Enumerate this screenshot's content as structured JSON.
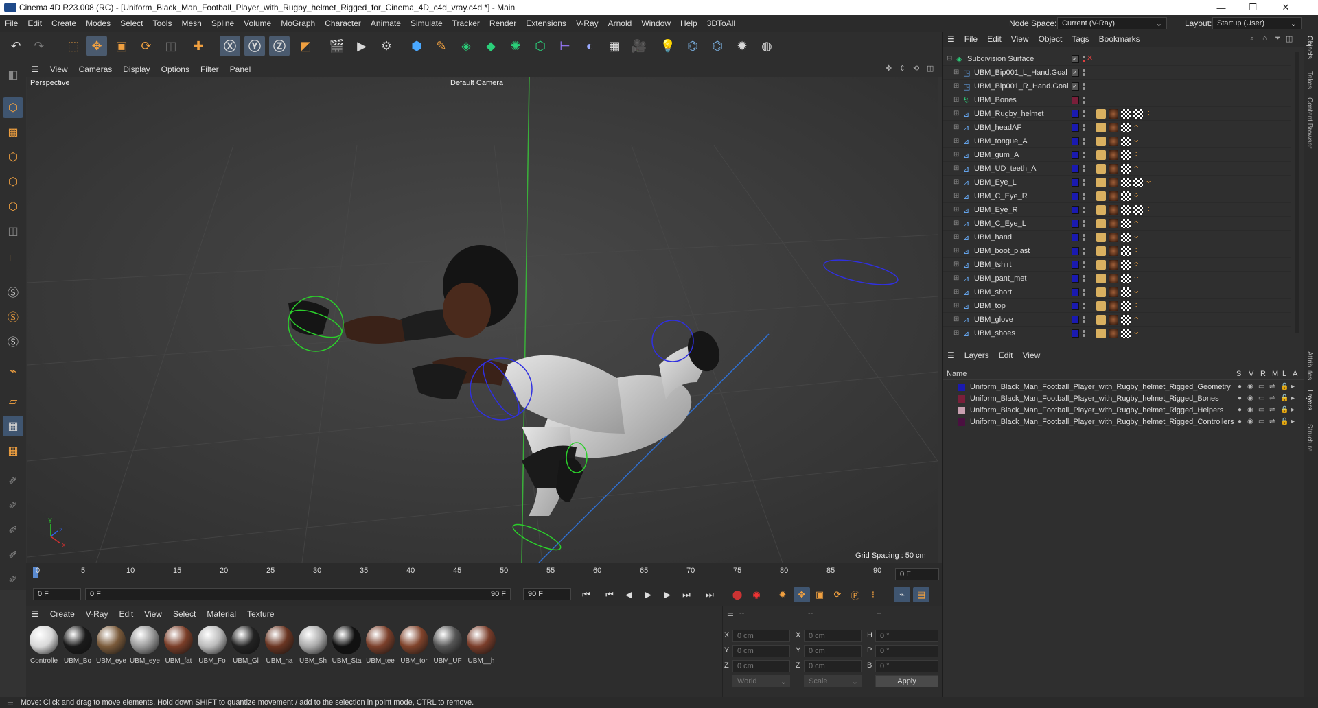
{
  "window": {
    "title": "Cinema 4D R23.008 (RC) - [Uniform_Black_Man_Football_Player_with_Rugby_helmet_Rigged_for_Cinema_4D_c4d_vray.c4d *] - Main"
  },
  "menubar": {
    "items": [
      "File",
      "Edit",
      "Create",
      "Modes",
      "Select",
      "Tools",
      "Mesh",
      "Spline",
      "Volume",
      "MoGraph",
      "Character",
      "Animate",
      "Simulate",
      "Tracker",
      "Render",
      "Extensions",
      "V-Ray",
      "Arnold",
      "Window",
      "Help",
      "3DToAll"
    ],
    "node_space_label": "Node Space:",
    "node_space_value": "Current (V-Ray)",
    "layout_label": "Layout:",
    "layout_value": "Startup (User)"
  },
  "viewport": {
    "menu": [
      "View",
      "Cameras",
      "Display",
      "Options",
      "Filter",
      "Panel"
    ],
    "view_name": "Perspective",
    "camera": "Default Camera",
    "grid_spacing": "Grid Spacing : 50 cm"
  },
  "timeline": {
    "ticks": [
      "0",
      "5",
      "10",
      "15",
      "20",
      "25",
      "30",
      "35",
      "40",
      "45",
      "50",
      "55",
      "60",
      "65",
      "70",
      "75",
      "80",
      "85",
      "90"
    ],
    "current_frame_right": "0 F",
    "start_frame": "0 F",
    "current_frame": "0 F",
    "end_frame_a": "90 F",
    "end_frame_b": "90 F"
  },
  "materials": {
    "menu": [
      "Create",
      "V-Ray",
      "Edit",
      "View",
      "Select",
      "Material",
      "Texture"
    ],
    "items": [
      {
        "label": "Controlle",
        "color": "#d8d8d8"
      },
      {
        "label": "UBM_Bo",
        "color": "#1a1a1a"
      },
      {
        "label": "UBM_eye",
        "color": "#7a5a3a"
      },
      {
        "label": "UBM_eye",
        "color": "#9a9a9a"
      },
      {
        "label": "UBM_fat",
        "color": "#7a3d28"
      },
      {
        "label": "UBM_Fo",
        "color": "#bbbbbb"
      },
      {
        "label": "UBM_Gl",
        "color": "#222222"
      },
      {
        "label": "UBM_ha",
        "color": "#6a3522"
      },
      {
        "label": "UBM_Sh",
        "color": "#aaaaaa"
      },
      {
        "label": "UBM_Sta",
        "color": "#111111"
      },
      {
        "label": "UBM_tee",
        "color": "#7b3f2a"
      },
      {
        "label": "UBM_tor",
        "color": "#80432b"
      },
      {
        "label": "UBM_UF",
        "color": "#555555"
      },
      {
        "label": "UBM__h",
        "color": "#7a3d2a"
      }
    ]
  },
  "coords": {
    "x_pos": "0 cm",
    "y_pos": "0 cm",
    "z_pos": "0 cm",
    "x_size": "0 cm",
    "y_size": "0 cm",
    "z_size": "0 cm",
    "h": "0 °",
    "p": "0 °",
    "b": "0 °",
    "mode": "World",
    "scale": "Scale",
    "apply": "Apply",
    "labels": {
      "x": "X",
      "y": "Y",
      "z": "Z",
      "h": "H",
      "p": "P",
      "b": "B"
    }
  },
  "objects": {
    "menu": [
      "File",
      "Edit",
      "View",
      "Object",
      "Tags",
      "Bookmarks"
    ],
    "rows": [
      {
        "name": "Subdivision Surface",
        "indent": 0,
        "layer": "none"
      },
      {
        "name": "UBM_Bip001_L_Hand.Goal",
        "indent": 1,
        "layer": "none"
      },
      {
        "name": "UBM_Bip001_R_Hand.Goal",
        "indent": 1,
        "layer": "none"
      },
      {
        "name": "UBM_Bones",
        "indent": 1,
        "layer": "#7a1f3a"
      },
      {
        "name": "UBM_Rugby_helmet",
        "indent": 1,
        "layer": "#1a1ab0"
      },
      {
        "name": "UBM_headAF",
        "indent": 1,
        "layer": "#1a1ab0"
      },
      {
        "name": "UBM_tongue_A",
        "indent": 1,
        "layer": "#1a1ab0"
      },
      {
        "name": "UBM_gum_A",
        "indent": 1,
        "layer": "#1a1ab0"
      },
      {
        "name": "UBM_UD_teeth_A",
        "indent": 1,
        "layer": "#1a1ab0"
      },
      {
        "name": "UBM_Eye_L",
        "indent": 1,
        "layer": "#1a1ab0"
      },
      {
        "name": "UBM_C_Eye_R",
        "indent": 1,
        "layer": "#1a1ab0"
      },
      {
        "name": "UBM_Eye_R",
        "indent": 1,
        "layer": "#1a1ab0"
      },
      {
        "name": "UBM_C_Eye_L",
        "indent": 1,
        "layer": "#1a1ab0"
      },
      {
        "name": "UBM_hand",
        "indent": 1,
        "layer": "#1a1ab0"
      },
      {
        "name": "UBM_boot_plast",
        "indent": 1,
        "layer": "#1a1ab0"
      },
      {
        "name": "UBM_tshirt",
        "indent": 1,
        "layer": "#1a1ab0"
      },
      {
        "name": "UBM_pant_met",
        "indent": 1,
        "layer": "#1a1ab0"
      },
      {
        "name": "UBM_short",
        "indent": 1,
        "layer": "#1a1ab0"
      },
      {
        "name": "UBM_top",
        "indent": 1,
        "layer": "#1a1ab0"
      },
      {
        "name": "UBM_glove",
        "indent": 1,
        "layer": "#1a1ab0"
      },
      {
        "name": "UBM_shoes",
        "indent": 1,
        "layer": "#1a1ab0"
      }
    ]
  },
  "layers": {
    "menu": [
      "Layers",
      "Edit",
      "View"
    ],
    "header": {
      "name": "Name",
      "s": "S",
      "v": "V",
      "r": "R",
      "m": "M",
      "l": "L",
      "a": "A"
    },
    "rows": [
      {
        "name": "Uniform_Black_Man_Football_Player_with_Rugby_helmet_Rigged_Geometry",
        "color": "#1a1ab0"
      },
      {
        "name": "Uniform_Black_Man_Football_Player_with_Rugby_helmet_Rigged_Bones",
        "color": "#7a1f3a"
      },
      {
        "name": "Uniform_Black_Man_Football_Player_with_Rugby_helmet_Rigged_Helpers",
        "color": "#c8a0b0"
      },
      {
        "name": "Uniform_Black_Man_Football_Player_with_Rugby_helmet_Rigged_Controllers",
        "color": "#4a1040"
      }
    ]
  },
  "right_tabs": [
    "Objects",
    "Takes",
    "Content Browser",
    "Attributes",
    "Layers",
    "Structure"
  ],
  "status": "Move: Click and drag to move elements. Hold down SHIFT to quantize movement / add to the selection in point mode, CTRL to remove."
}
